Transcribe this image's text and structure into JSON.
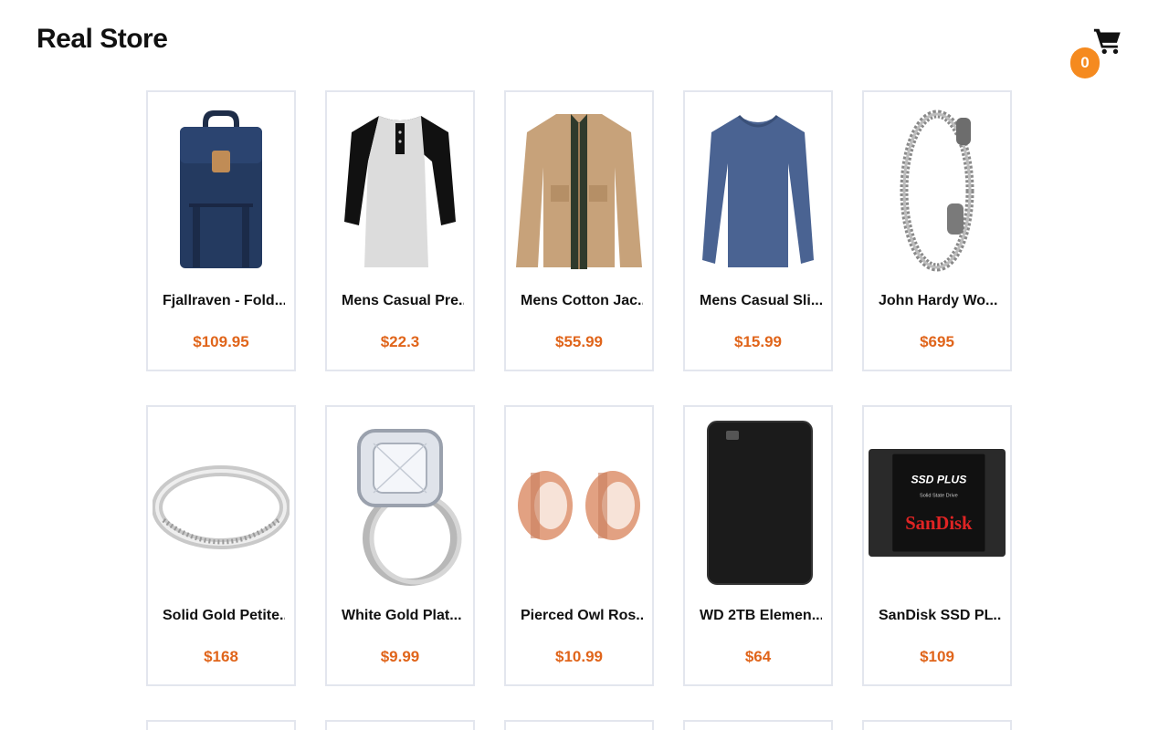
{
  "header": {
    "brand": "Real Store",
    "cart_icon": "shopping-cart-icon",
    "cart_count": "0"
  },
  "colors": {
    "price": "#e0651b",
    "badge": "#f58a1f",
    "card_border": "#e3e6ee"
  },
  "products": [
    {
      "title": "Fjallraven - Fold...",
      "price": "$109.95",
      "icon": "backpack-image"
    },
    {
      "title": "Mens Casual Pre...",
      "price": "$22.3",
      "icon": "raglan-tshirt-image"
    },
    {
      "title": "Mens Cotton Jac...",
      "price": "$55.99",
      "icon": "cotton-jacket-image"
    },
    {
      "title": "Mens Casual Sli...",
      "price": "$15.99",
      "icon": "long-sleeve-shirt-image"
    },
    {
      "title": "John Hardy Wo...",
      "price": "$695",
      "icon": "chain-bracelet-image"
    },
    {
      "title": "Solid Gold Petite...",
      "price": "$168",
      "icon": "silver-ring-image"
    },
    {
      "title": "White Gold Plat...",
      "price": "$9.99",
      "icon": "diamond-ring-image"
    },
    {
      "title": "Pierced Owl Ros...",
      "price": "$10.99",
      "icon": "rose-gold-plugs-image"
    },
    {
      "title": "WD 2TB Elemen...",
      "price": "$64",
      "icon": "external-hard-drive-image"
    },
    {
      "title": "SanDisk SSD PL...",
      "price": "$109",
      "icon": "sandisk-ssd-image"
    }
  ],
  "ssd_label": {
    "line1": "SSD PLUS",
    "line2": "Solid State Drive",
    "brand": "SanDisk"
  }
}
